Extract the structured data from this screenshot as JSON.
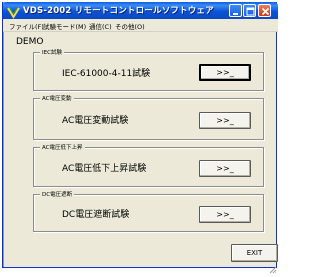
{
  "window": {
    "title": "VDS-2002 リモートコントロールソフトウェア",
    "app_icon": "app-logo-icon",
    "controls": [
      "minimize-icon",
      "maximize-icon",
      "close-icon"
    ]
  },
  "menu": {
    "items": [
      {
        "label": "ファイル(F)"
      },
      {
        "label": "試験モード(M)"
      },
      {
        "label": "通信(C)"
      },
      {
        "label": "その他(O)"
      }
    ]
  },
  "mode_label": "DEMO",
  "groups": [
    {
      "legend": "IEC試験",
      "test_label": "IEC-61000-4-11試験",
      "button": ">>_"
    },
    {
      "legend": "AC電圧変動",
      "test_label": "AC電圧変動試験",
      "button": ">>_"
    },
    {
      "legend": "AC電圧低下上昇",
      "test_label": "AC電圧低下上昇試験",
      "button": ">>_"
    },
    {
      "legend": "DC電圧遮断",
      "test_label": "DC電圧遮断試験",
      "button": ">>_"
    }
  ],
  "exit_button": "EXIT",
  "colors": {
    "titlebar": "#0a5fe8",
    "window_bg": "#ece9d8",
    "close_button": "#c63a14"
  }
}
